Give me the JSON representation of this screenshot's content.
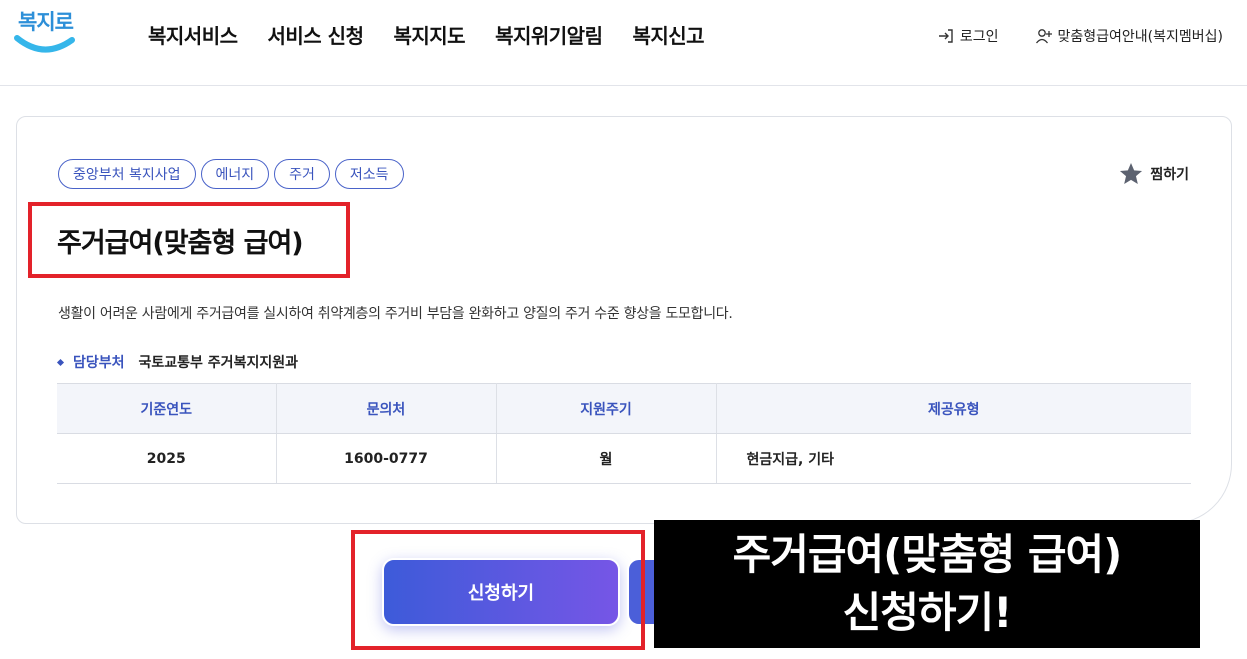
{
  "header": {
    "logo_text": "복지로",
    "nav": [
      "복지서비스",
      "서비스 신청",
      "복지지도",
      "복지위기알림",
      "복지신고"
    ],
    "login_label": "로그인",
    "membership_label": "맞춤형급여안내(복지멤버십)"
  },
  "service": {
    "tags": [
      "중앙부처 복지사업",
      "에너지",
      "주거",
      "저소득"
    ],
    "favorite_label": "찜하기",
    "title": "주거급여(맞춤형 급여)",
    "description": "생활이 어려운 사람에게 주거급여를 실시하여 취약계층의 주거비 부담을 완화하고 양질의 주거 수준 향상을 도모합니다.",
    "department_label": "담당부처",
    "department_value": "국토교통부 주거복지지원과",
    "table": {
      "headers": [
        "기준연도",
        "문의처",
        "지원주기",
        "제공유형"
      ],
      "row": [
        "2025",
        "1600-0777",
        "월",
        "현금지급, 기타"
      ]
    },
    "apply_label": "신청하기"
  },
  "caption": {
    "line1": "주거급여(맞춤형 급여)",
    "line2": "신청하기!"
  },
  "colors": {
    "accent": "#3a54bd",
    "highlight": "#e3222a",
    "button_start": "#3d5bd9",
    "button_end": "#7656e6"
  }
}
